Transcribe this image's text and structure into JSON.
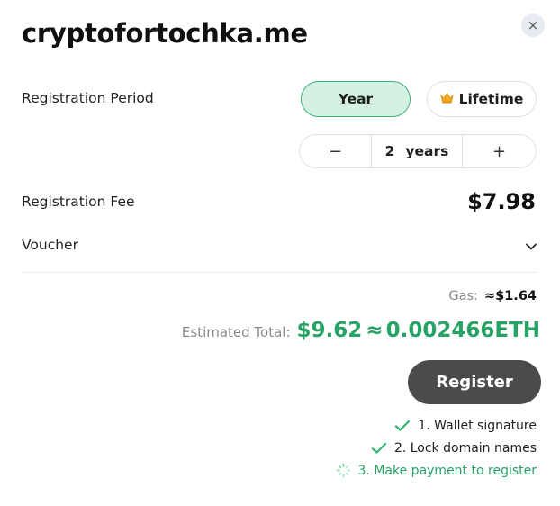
{
  "title": "cryptofortochka.me",
  "close_icon": "×",
  "registration_period": {
    "label": "Registration Period",
    "options": [
      "Year",
      "Lifetime"
    ],
    "selected": "Year",
    "lifetime_icon": "crown-icon",
    "stepper": {
      "minus": "−",
      "value": "2",
      "unit": "years",
      "plus": "+"
    }
  },
  "fee": {
    "label": "Registration Fee",
    "value": "$7.98"
  },
  "voucher": {
    "label": "Voucher",
    "icon": "chevron-down-icon"
  },
  "gas": {
    "label": "Gas:",
    "value": "≈$1.64"
  },
  "total": {
    "label": "Estimated Total:",
    "usd": "$9.62",
    "approx": "≈",
    "eth": "0.002466ETH"
  },
  "register_label": "Register",
  "steps": [
    {
      "label": "1. Wallet signature",
      "status": "done"
    },
    {
      "label": "2. Lock domain names",
      "status": "done"
    },
    {
      "label": "3. Make payment to register",
      "status": "in-progress"
    }
  ],
  "colors": {
    "accent_green": "#28a366",
    "selected_fill": "#d4f1e2",
    "button_dark": "#4b4b4b"
  }
}
